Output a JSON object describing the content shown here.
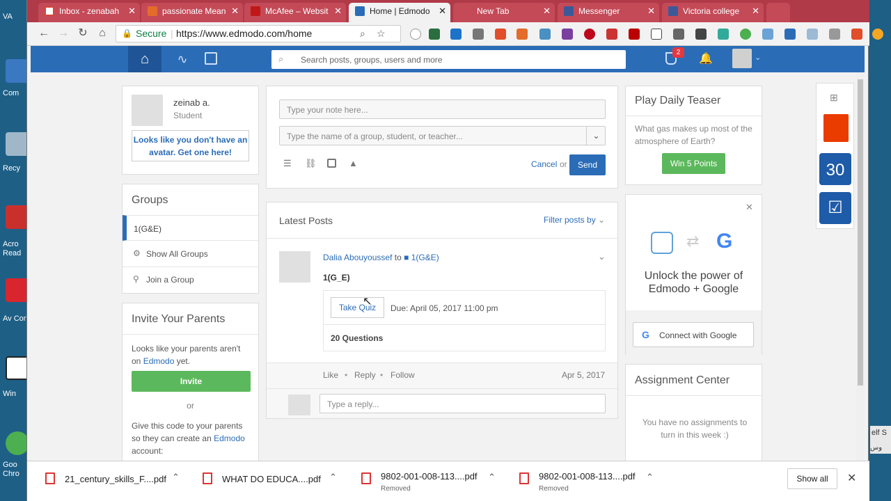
{
  "desktop": {
    "left_labels": [
      "VA",
      "Com",
      "Recy",
      "Acro Read",
      "Av Con",
      "Win",
      "Goo Chro"
    ],
    "right_labels": [
      "elf S",
      "وس"
    ]
  },
  "tabs": [
    {
      "title": "Inbox - zenabah",
      "color": "#d44638"
    },
    {
      "title": "passionate Mean",
      "color": "#e36c2b"
    },
    {
      "title": "McAfee – Websit",
      "color": "#c01818"
    },
    {
      "title": "Home | Edmodo",
      "color": "#2b6cb7"
    },
    {
      "title": "New Tab",
      "color": "#ffffff"
    },
    {
      "title": "Messenger",
      "color": "#3b5998"
    },
    {
      "title": "Victoria college",
      "color": "#3b5998"
    }
  ],
  "omnibox": {
    "secure": "Secure",
    "url": "https://www.edmodo.com/home"
  },
  "edmodo": {
    "search_placeholder": "Search posts, groups, users and more",
    "notif_count": "2",
    "profile": {
      "name": "zeinab a.",
      "role": "Student",
      "avatar_prompt": "Looks like you don't have an avatar. Get one here!"
    },
    "groups": {
      "title": "Groups",
      "items": [
        "1(G&E)"
      ],
      "show_all": "Show All Groups",
      "join": "Join a Group"
    },
    "invite": {
      "title": "Invite Your Parents",
      "text1": "Looks like your parents aren't on",
      "brand": "Edmodo",
      "text2": "yet.",
      "button": "Invite",
      "or": "or",
      "code_text1": "Give this code to your parents so they can create an",
      "code_text2": "account:"
    },
    "composer": {
      "note_placeholder": "Type your note here...",
      "to_placeholder": "Type the name of a group, student, or teacher...",
      "cancel": "Cancel",
      "or": "or",
      "send": "Send"
    },
    "latest": {
      "title": "Latest Posts",
      "filter": "Filter posts by"
    },
    "post": {
      "author": "Dalia Abouyoussef",
      "to": "to",
      "group": "1(G&E)",
      "body": "1(G_E)",
      "take_quiz": "Take Quiz",
      "due": "Due: April 05, 2017 11:00 pm",
      "questions": "20 Questions",
      "like": "Like",
      "reply": "Reply",
      "follow": "Follow",
      "date": "Apr 5, 2017",
      "reply_placeholder": "Type a reply..."
    },
    "teaser": {
      "title": "Play Daily Teaser",
      "question": "What gas makes up most of the atmosphere of Earth?",
      "button": "Win 5 Points"
    },
    "google": {
      "text": "Unlock the power of Edmodo + Google",
      "button": "Connect with Google"
    },
    "assign": {
      "title": "Assignment Center",
      "empty": "You have no assignments to turn in this week :)"
    },
    "side_apps": {
      "calendar_day": "30"
    }
  },
  "downloads": [
    {
      "name": "21_century_skills_F....pdf",
      "status": ""
    },
    {
      "name": "WHAT DO EDUCA....pdf",
      "status": ""
    },
    {
      "name": "9802-001-008-113....pdf",
      "status": "Removed"
    },
    {
      "name": "9802-001-008-113....pdf",
      "status": "Removed"
    }
  ],
  "show_all": "Show all"
}
